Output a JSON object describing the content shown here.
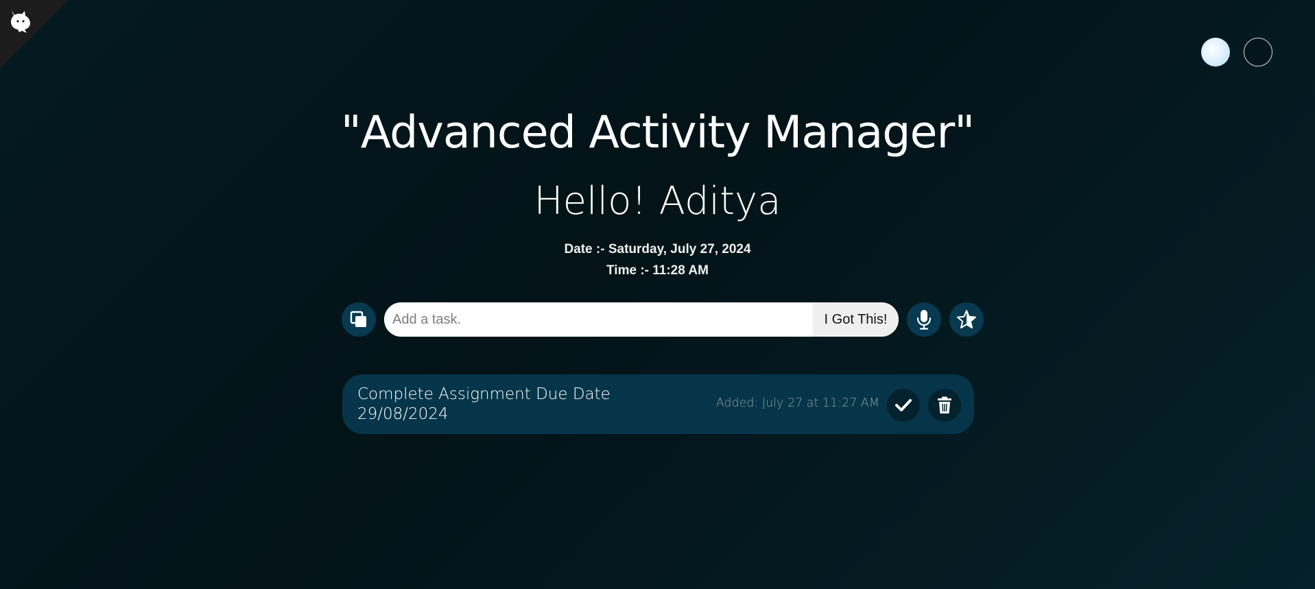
{
  "header": {
    "logo_icon": "github-cat-icon",
    "theme_options": [
      "light",
      "dark"
    ]
  },
  "main": {
    "title": "\"Advanced Activity Manager\"",
    "greeting": "Hello! Aditya",
    "date_line": "Date :- Saturday, July 27, 2024",
    "time_line": "Time :- 11:28 AM"
  },
  "task_form": {
    "placeholder": "Add a task.",
    "value": "",
    "submit_label": "I Got This!",
    "left_icon": "copy-icon",
    "mic_icon": "microphone-icon",
    "star_icon": "star-icon"
  },
  "tasks": [
    {
      "text": "Complete Assignment Due Date 29/08/2024",
      "added": "Added: July 27 at 11:27 AM",
      "complete_icon": "check-icon",
      "delete_icon": "trash-icon"
    }
  ],
  "colors": {
    "background": "#031318",
    "accent_button": "#073a50",
    "task_background": "#063549",
    "text": "#ffffff"
  }
}
